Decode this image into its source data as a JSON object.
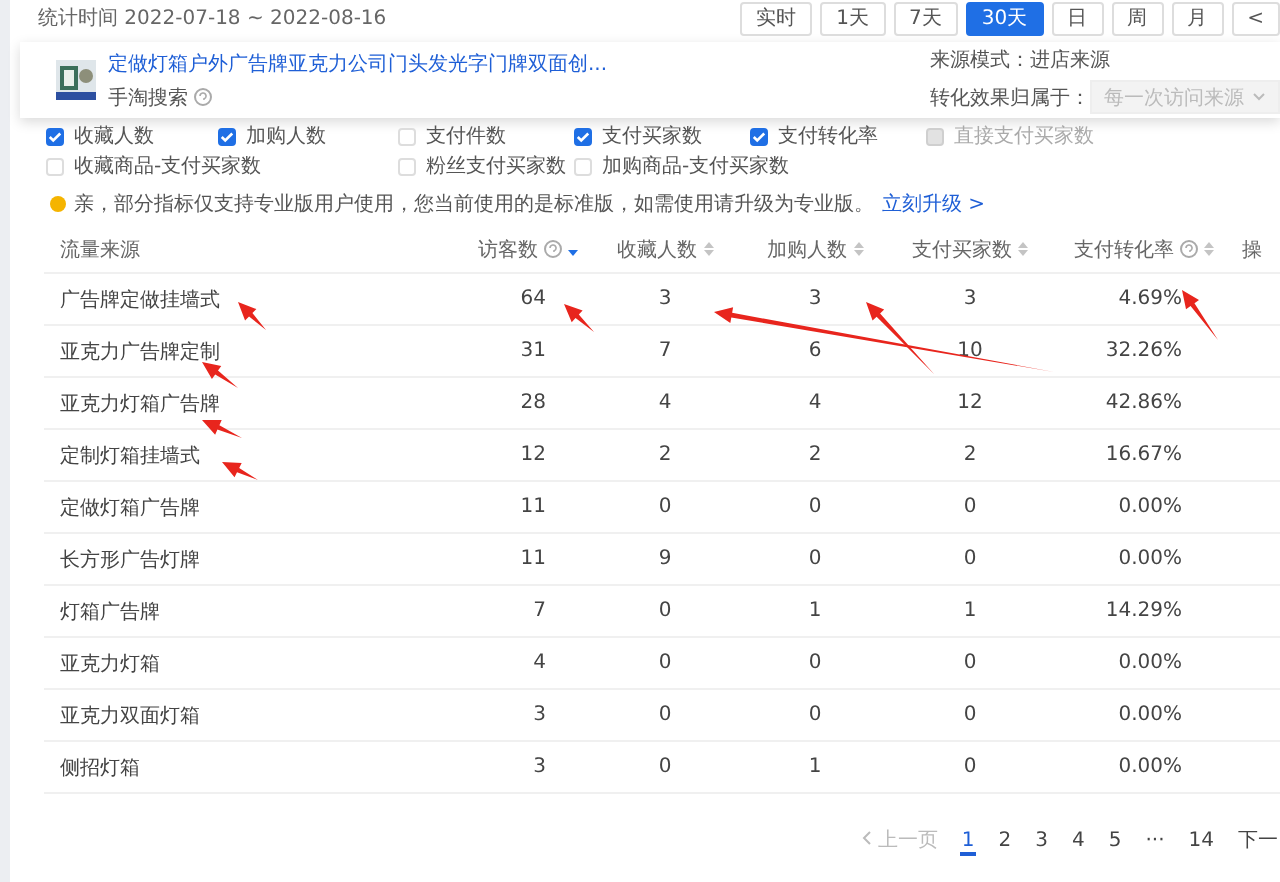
{
  "header": {
    "date_range": "统计时间 2022-07-18 ~ 2022-08-16",
    "periods": [
      {
        "label": "实时",
        "selected": false
      },
      {
        "label": "1天",
        "selected": false
      },
      {
        "label": "7天",
        "selected": false
      },
      {
        "label": "30天",
        "selected": true
      },
      {
        "label": "日",
        "selected": false
      },
      {
        "label": "周",
        "selected": false
      },
      {
        "label": "月",
        "selected": false
      },
      {
        "label": "<",
        "selected": false
      }
    ]
  },
  "product_card": {
    "title": "定做灯箱户外广告牌亚克力公司门头发光字门牌双面创...",
    "source": "手淘搜索",
    "mode": "来源模式：进店来源",
    "attribution_label": "转化效果归属于：",
    "attribution_select": {
      "value": "每一次访问来源",
      "disabled": true
    }
  },
  "metrics_row_1": [
    {
      "label": "收藏人数",
      "checked": true,
      "disabled": false
    },
    {
      "label": "加购人数",
      "checked": true,
      "disabled": false
    },
    {
      "label": "支付件数",
      "checked": false,
      "disabled": false
    },
    {
      "label": "支付买家数",
      "checked": true,
      "disabled": false
    },
    {
      "label": "支付转化率",
      "checked": true,
      "disabled": false
    },
    {
      "label": "直接支付买家数",
      "checked": false,
      "disabled": true
    }
  ],
  "metrics_row_2": [
    {
      "label": "收藏商品-支付买家数",
      "checked": false,
      "disabled": false
    },
    {
      "label": "粉丝支付买家数",
      "checked": false,
      "disabled": false
    },
    {
      "label": "加购商品-支付买家数",
      "checked": false,
      "disabled": false
    }
  ],
  "notice": {
    "text": "亲，部分指标仅支持专业版用户使用，您当前使用的是标准版，如需使用请升级为专业版。",
    "link": "立刻升级 >"
  },
  "table": {
    "columns": [
      {
        "label": "流量来源",
        "kind": "plain"
      },
      {
        "label": "访客数",
        "kind": "help-sortable",
        "sorted": true
      },
      {
        "label": "收藏人数",
        "kind": "sortable",
        "sorted": false
      },
      {
        "label": "加购人数",
        "kind": "sortable",
        "sorted": false
      },
      {
        "label": "支付买家数",
        "kind": "sortable",
        "sorted": false
      },
      {
        "label": "支付转化率",
        "kind": "help-sortable",
        "sorted": false
      },
      {
        "label": "操",
        "kind": "plain"
      }
    ],
    "rows": [
      [
        "广告牌定做挂墙式",
        "64",
        "3",
        "3",
        "3",
        "4.69%"
      ],
      [
        "亚克力广告牌定制",
        "31",
        "7",
        "6",
        "10",
        "32.26%"
      ],
      [
        "亚克力灯箱广告牌",
        "28",
        "4",
        "4",
        "12",
        "42.86%"
      ],
      [
        "定制灯箱挂墙式",
        "12",
        "2",
        "2",
        "2",
        "16.67%"
      ],
      [
        "定做灯箱广告牌",
        "11",
        "0",
        "0",
        "0",
        "0.00%"
      ],
      [
        "长方形广告灯牌",
        "11",
        "9",
        "0",
        "0",
        "0.00%"
      ],
      [
        "灯箱广告牌",
        "7",
        "0",
        "1",
        "1",
        "14.29%"
      ],
      [
        "亚克力灯箱",
        "4",
        "0",
        "0",
        "0",
        "0.00%"
      ],
      [
        "亚克力双面灯箱",
        "3",
        "0",
        "0",
        "0",
        "0.00%"
      ],
      [
        "侧招灯箱",
        "3",
        "0",
        "1",
        "0",
        "0.00%"
      ]
    ]
  },
  "pagination": {
    "prev": {
      "label": "上一页",
      "disabled": true
    },
    "pages": [
      {
        "label": "1",
        "selected": true
      },
      {
        "label": "2",
        "selected": false
      },
      {
        "label": "3",
        "selected": false
      },
      {
        "label": "4",
        "selected": false
      },
      {
        "label": "5",
        "selected": false
      },
      {
        "label": "···",
        "selected": false
      },
      {
        "label": "14",
        "selected": false
      }
    ],
    "next": {
      "label": "下一",
      "disabled": false
    }
  }
}
